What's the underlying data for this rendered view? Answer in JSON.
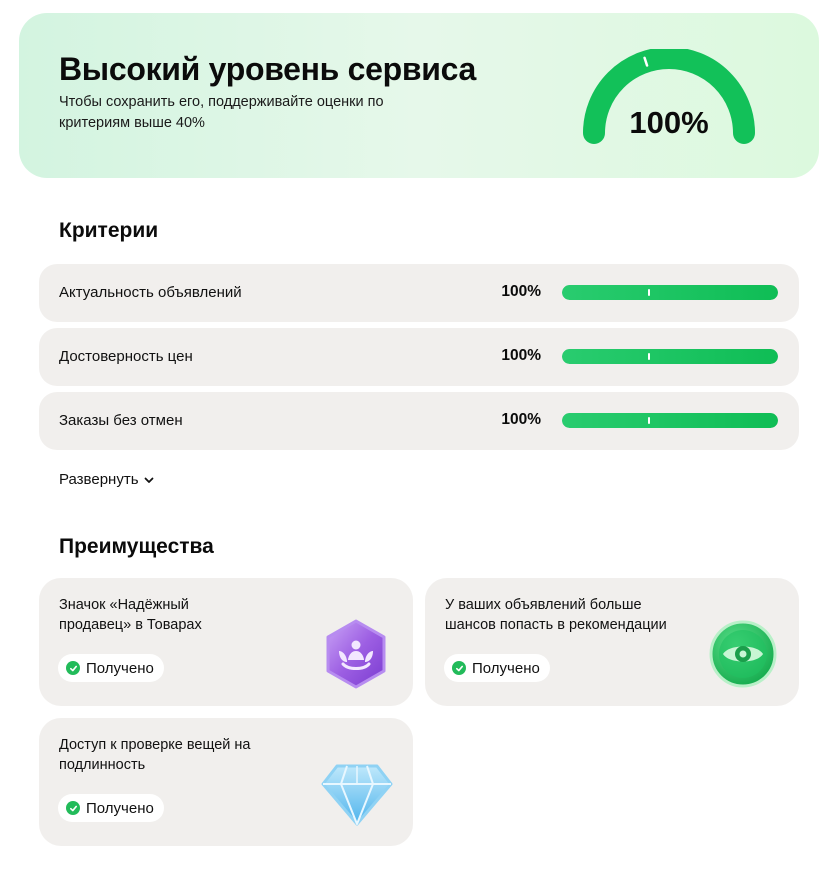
{
  "hero": {
    "title": "Высокий уровень сервиса",
    "subtitle": "Чтобы сохранить его, поддерживайте оценки по критериям выше 40%",
    "gauge_value": "100%",
    "gauge_fraction": 1.0,
    "gauge_threshold_fraction": 0.4
  },
  "criteria": {
    "title": "Критерии",
    "rows": [
      {
        "label": "Актуальность объявлений",
        "value": "100%",
        "fraction": 1.0
      },
      {
        "label": "Достоверность цен",
        "value": "100%",
        "fraction": 1.0
      },
      {
        "label": "Заказы без отмен",
        "value": "100%",
        "fraction": 1.0
      }
    ],
    "threshold_fraction": 0.4,
    "expand_label": "Развернуть"
  },
  "benefits": {
    "title": "Преимущества",
    "cards": [
      {
        "text": "Значок «Надёжный продавец» в Товарах",
        "status": "Получено",
        "icon": "lotus-badge-icon"
      },
      {
        "text": "У ваших объявлений больше шансов попасть в рекомендации",
        "status": "Получено",
        "icon": "eye-badge-icon"
      },
      {
        "text": "Доступ к проверке вещей на подлинность",
        "status": "Получено",
        "icon": "diamond-icon"
      }
    ]
  },
  "colors": {
    "accent_green": "#12c159",
    "hero_bg": "#d3f4e0",
    "card_bg": "#f1efed",
    "badge_purple": "#9b5ee0",
    "diamond_blue": "#6cc7f5"
  }
}
